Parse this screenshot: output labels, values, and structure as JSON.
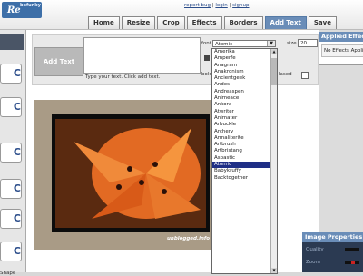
{
  "logo": {
    "text": "Re",
    "sub": "befunky"
  },
  "toplinks": {
    "report": "report bug",
    "login": "login",
    "signup": "signup",
    "sep": "|"
  },
  "tabs": [
    {
      "label": "Home"
    },
    {
      "label": "Resize"
    },
    {
      "label": "Crop"
    },
    {
      "label": "Effects"
    },
    {
      "label": "Borders"
    },
    {
      "label": "Add Text"
    },
    {
      "label": "Save"
    }
  ],
  "addtext": {
    "button_label": "Add Text",
    "hint": "Type your text. Click add text.",
    "font_label": "font",
    "font_value": "Atomic",
    "size_label": "size",
    "size_value": "20",
    "bold_label": "bold",
    "aliased_label": "lased"
  },
  "font_options": [
    "Amerika",
    "Amperfe",
    "Anagram",
    "Anakronism",
    "Ancientgeek",
    "Andes",
    "Andreaspen",
    "Animeace",
    "Ankora",
    "Atwriter",
    "Animater",
    "Arbuckle",
    "Archery",
    "Armaliterite",
    "Artbrush",
    "Artbristang",
    "Aspastic",
    "Atomic",
    "Babykruffy",
    "Backtogether"
  ],
  "font_selected_index": 17,
  "left_panel": {
    "shape_label": "Shape"
  },
  "applied_effects": {
    "title": "Applied Effects",
    "content": "No Effects Applied"
  },
  "image_properties": {
    "title": "Image Properties",
    "rows": [
      {
        "label": "Quality"
      },
      {
        "label": "Zoom"
      }
    ]
  },
  "watermark": "unblogged.info",
  "colors": {
    "accent": "#6a8db8",
    "selection": "#1f2f86",
    "logo": "#3d6fa8"
  }
}
